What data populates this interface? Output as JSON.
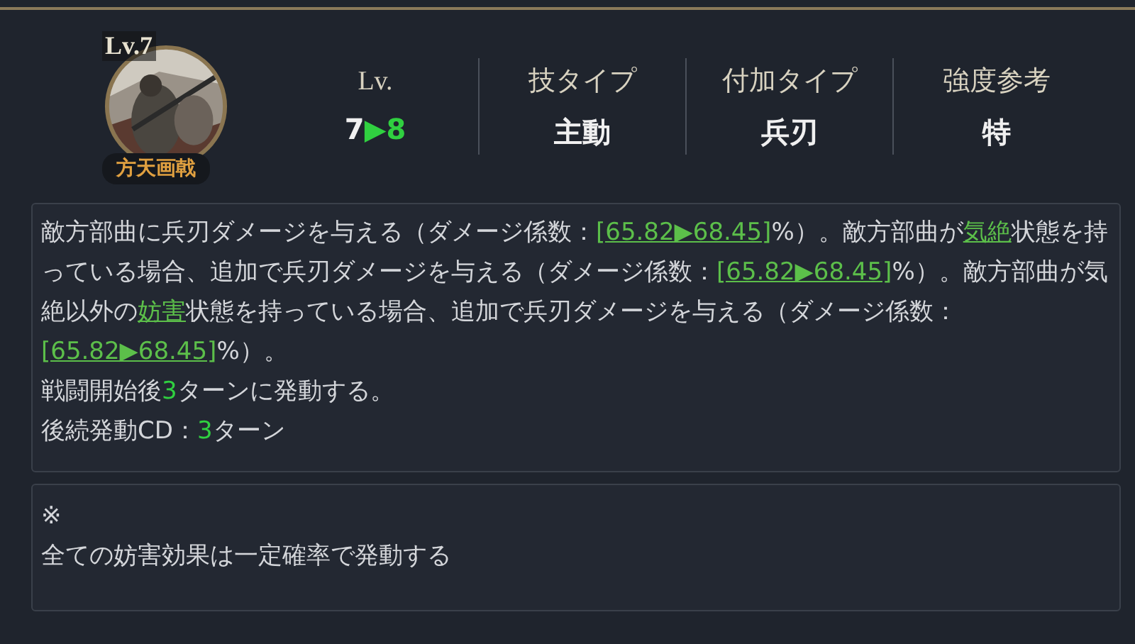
{
  "skill": {
    "kind": "picture",
    "level_badge": "Lv.7",
    "name": "方天画戟"
  },
  "stats": [
    {
      "kind": "level",
      "label": "Lv.",
      "from": "7",
      "arrow": "▶",
      "to": "8"
    },
    {
      "kind": "text",
      "label": "技タイプ",
      "value": "主動"
    },
    {
      "kind": "text",
      "label": "付加タイプ",
      "value": "兵刃"
    },
    {
      "kind": "text",
      "label": "強度参考",
      "value": "特"
    }
  ],
  "description": [
    [
      {
        "kind": "text",
        "text": "敵方部曲に兵刃ダメージを与える（ダメージ係数："
      },
      {
        "kind": "link",
        "text": "[65.82▶68.45]"
      },
      {
        "kind": "text",
        "text": "%）。敵方部曲が"
      },
      {
        "kind": "link",
        "text": "気絶"
      },
      {
        "kind": "text",
        "text": "状態を持っている場合、追加で兵刃ダメージを与える（ダメージ係数："
      },
      {
        "kind": "link",
        "text": "[65.82▶68.45]"
      },
      {
        "kind": "text",
        "text": "%）。敵方部曲が気絶以外の"
      },
      {
        "kind": "link",
        "text": "妨害"
      },
      {
        "kind": "text",
        "text": "状態を持っている場合、追加で兵刃ダメージを与える（ダメージ係数："
      },
      {
        "kind": "link",
        "text": "[65.82▶68.45]"
      },
      {
        "kind": "text",
        "text": "%）。"
      }
    ],
    [
      {
        "kind": "text",
        "text": "戦闘開始後"
      },
      {
        "kind": "number",
        "text": "3"
      },
      {
        "kind": "text",
        "text": "ターンに発動する。"
      }
    ],
    [
      {
        "kind": "text",
        "text": "後続発動CD："
      },
      {
        "kind": "number",
        "text": "3"
      },
      {
        "kind": "text",
        "text": "ターン"
      }
    ]
  ],
  "note": {
    "mark": "※",
    "text": "全ての妨害効果は一定確率で発動する"
  }
}
